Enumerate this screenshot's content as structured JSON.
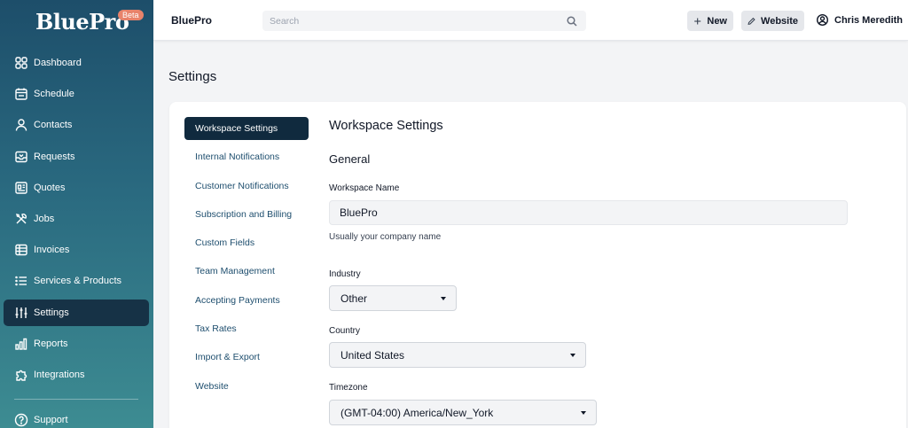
{
  "brand": {
    "name": "BluePro",
    "badge": "Beta"
  },
  "sidebar": {
    "items": [
      {
        "label": "Dashboard",
        "icon": "dashboard-icon"
      },
      {
        "label": "Schedule",
        "icon": "calendar-icon"
      },
      {
        "label": "Contacts",
        "icon": "person-icon"
      },
      {
        "label": "Requests",
        "icon": "inbox-icon"
      },
      {
        "label": "Quotes",
        "icon": "quote-icon"
      },
      {
        "label": "Jobs",
        "icon": "tools-icon"
      },
      {
        "label": "Invoices",
        "icon": "invoice-icon"
      },
      {
        "label": "Services & Products",
        "icon": "list-icon"
      },
      {
        "label": "Settings",
        "icon": "sliders-icon",
        "active": true
      },
      {
        "label": "Reports",
        "icon": "chart-icon"
      },
      {
        "label": "Integrations",
        "icon": "puzzle-icon"
      }
    ],
    "support": "Support"
  },
  "topbar": {
    "app_name": "BluePro",
    "search_placeholder": "Search",
    "new_label": "New",
    "website_label": "Website",
    "user_name": "Chris Meredith"
  },
  "page": {
    "title": "Settings"
  },
  "subnav": {
    "items": [
      {
        "label": "Workspace Settings",
        "active": true
      },
      {
        "label": "Internal Notifications"
      },
      {
        "label": "Customer Notifications"
      },
      {
        "label": "Subscription and Billing"
      },
      {
        "label": "Custom Fields"
      },
      {
        "label": "Team Management"
      },
      {
        "label": "Accepting Payments"
      },
      {
        "label": "Tax Rates"
      },
      {
        "label": "Import & Export"
      },
      {
        "label": "Website"
      }
    ]
  },
  "form": {
    "heading": "Workspace Settings",
    "section": "General",
    "workspace_name_label": "Workspace Name",
    "workspace_name_value": "BluePro",
    "workspace_name_hint": "Usually your company name",
    "industry_label": "Industry",
    "industry_value": "Other",
    "country_label": "Country",
    "country_value": "United States",
    "timezone_label": "Timezone",
    "timezone_value": "(GMT-04:00) America/New_York"
  },
  "colors": {
    "sidebar_top": "#1d4e6a",
    "sidebar_bottom": "#3d8c92",
    "active_nav": "#163246",
    "beta_badge": "#e8836b",
    "subnav_active": "#102a3e"
  }
}
